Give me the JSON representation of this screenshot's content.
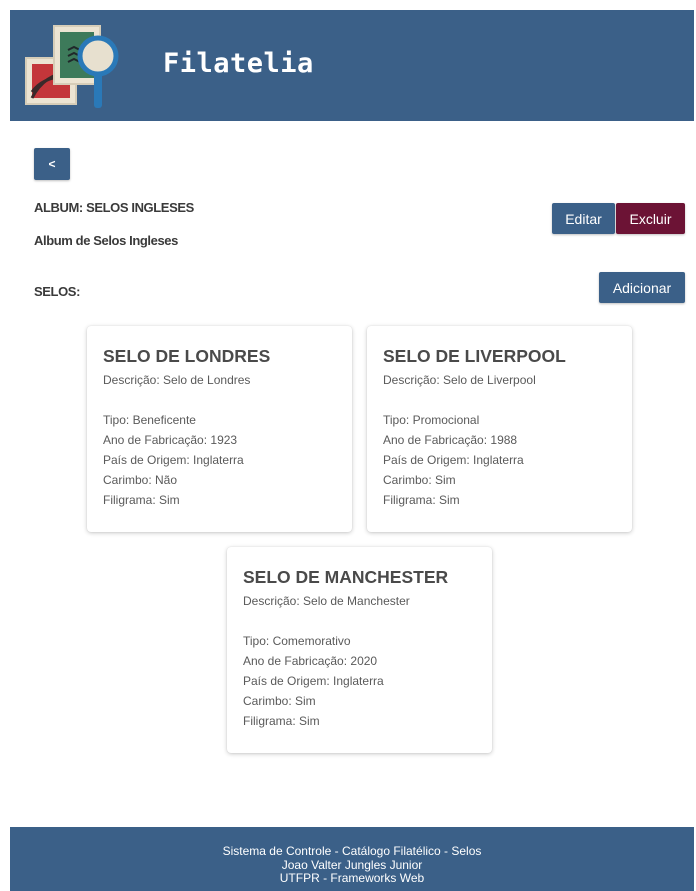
{
  "header": {
    "brand": "Filatelia",
    "logo_icon": "stamps-magnifier-icon"
  },
  "nav": {
    "back_label": "<"
  },
  "album": {
    "title": "ALBUM: SELOS INGLESES",
    "description": "Album de Selos Ingleses",
    "edit_label": "Editar",
    "delete_label": "Excluir"
  },
  "selos": {
    "label": "SELOS:",
    "add_label": "Adicionar",
    "cards": [
      {
        "title": "SELO DE LONDRES",
        "description": "Descrição: Selo de Londres",
        "tipo": "Tipo: Beneficente",
        "ano": "Ano de Fabricação: 1923",
        "pais": "País de Origem: Inglaterra",
        "carimbo": "Carimbo: Não",
        "filigrama": "Filigrama: Sim"
      },
      {
        "title": "SELO DE LIVERPOOL",
        "description": "Descrição: Selo de Liverpool",
        "tipo": "Tipo: Promocional",
        "ano": "Ano de Fabricação: 1988",
        "pais": "País de Origem: Inglaterra",
        "carimbo": "Carimbo: Sim",
        "filigrama": "Filigrama: Sim"
      },
      {
        "title": "SELO DE MANCHESTER",
        "description": "Descrição: Selo de Manchester",
        "tipo": "Tipo: Comemorativo",
        "ano": "Ano de Fabricação: 2020",
        "pais": "País de Origem: Inglaterra",
        "carimbo": "Carimbo: Sim",
        "filigrama": "Filigrama: Sim"
      }
    ]
  },
  "footer": {
    "line1": "Sistema de Controle - Catálogo Filatélico - Selos",
    "line2": "Joao Valter Jungles Junior",
    "line3": "UTFPR - Frameworks Web"
  },
  "colors": {
    "primary": "#3b6088",
    "danger": "#6c1335",
    "text": "#3a3a3a"
  }
}
